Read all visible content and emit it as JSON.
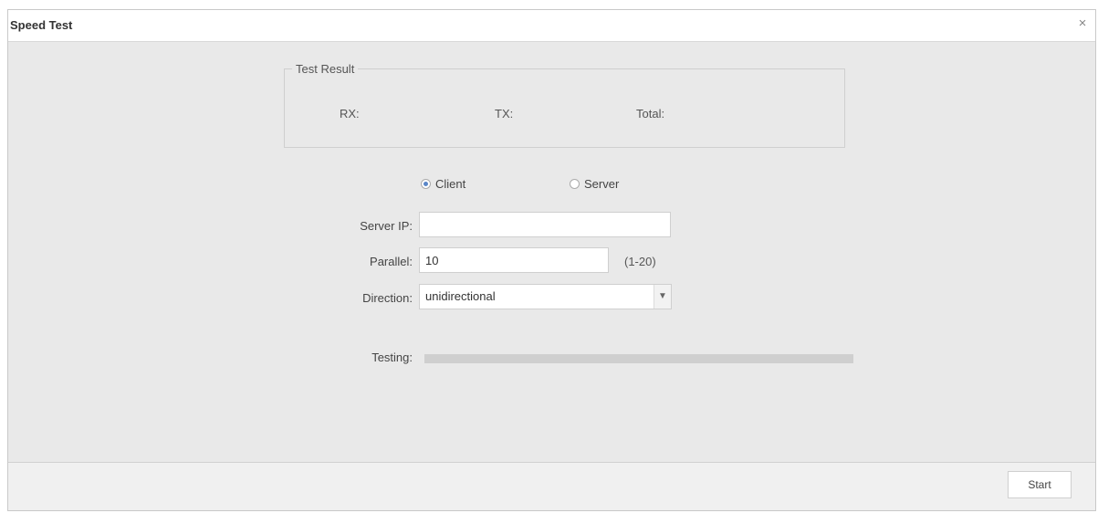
{
  "dialog": {
    "title": "Speed Test",
    "close_symbol": "×"
  },
  "result": {
    "legend": "Test Result",
    "rx_label": "RX:",
    "tx_label": "TX:",
    "total_label": "Total:"
  },
  "mode": {
    "client_label": "Client",
    "server_label": "Server",
    "selected": "client"
  },
  "form": {
    "server_ip_label": "Server IP:",
    "server_ip_value": "",
    "parallel_label": "Parallel:",
    "parallel_value": "10",
    "parallel_hint": "(1-20)",
    "direction_label": "Direction:",
    "direction_value": "unidirectional",
    "testing_label": "Testing:",
    "testing_progress": 0
  },
  "footer": {
    "start_label": "Start"
  },
  "icons": {
    "close": "close-icon",
    "dropdown": "chevron-down-icon"
  }
}
